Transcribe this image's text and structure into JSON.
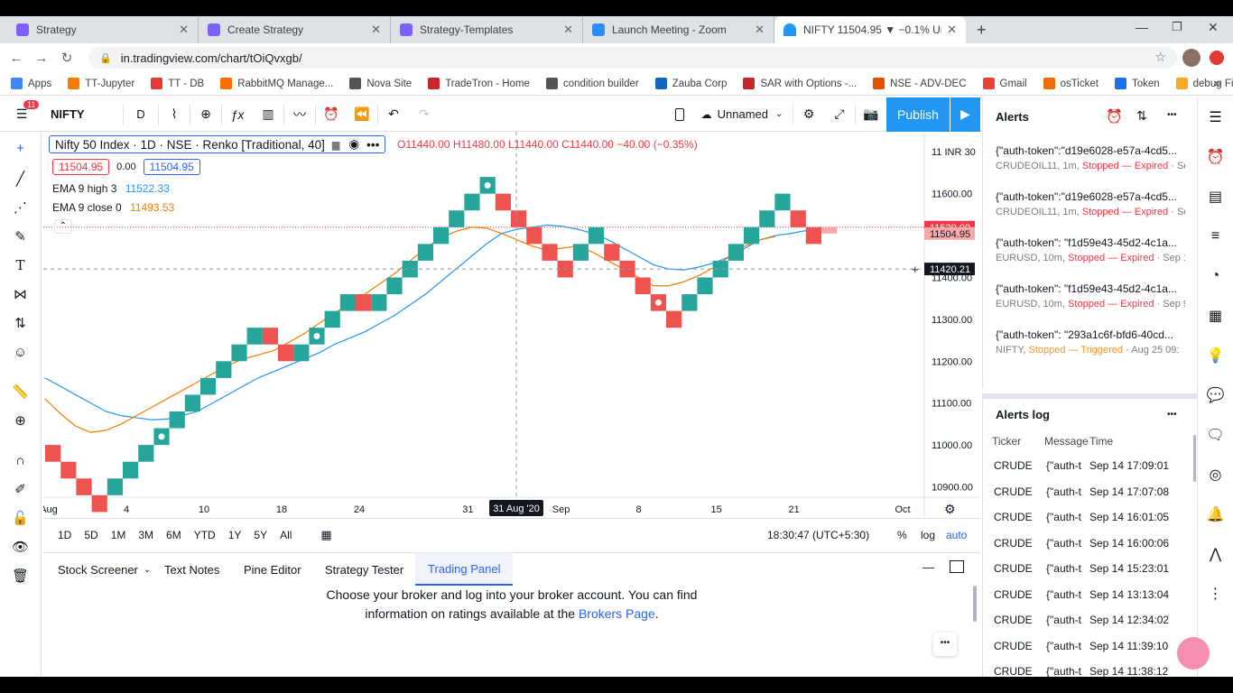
{
  "browser": {
    "tabs": [
      {
        "title": "Strategy",
        "color": "#7b61ff"
      },
      {
        "title": "Create Strategy",
        "color": "#7b61ff"
      },
      {
        "title": "Strategy-Templates",
        "color": "#7b61ff"
      },
      {
        "title": "Launch Meeting - Zoom",
        "color": "#2d8cff"
      },
      {
        "title": "NIFTY 11504.95 ▼ −0.1% Unnam",
        "color": "#2196f3"
      }
    ],
    "url": "in.tradingview.com/chart/tOiQvxgb/",
    "bookmarks": [
      {
        "label": "Apps",
        "color": "#4285f4"
      },
      {
        "label": "TT-Jupyter",
        "color": "#f57c00"
      },
      {
        "label": "TT - DB",
        "color": "#e53935"
      },
      {
        "label": "RabbitMQ Manage...",
        "color": "#ff6d00"
      },
      {
        "label": "Nova Site",
        "color": "#555555"
      },
      {
        "label": "TradeTron - Home",
        "color": "#c62828"
      },
      {
        "label": "condition builder",
        "color": "#555555"
      },
      {
        "label": "Zauba Corp",
        "color": "#1565c0"
      },
      {
        "label": "SAR with Options -...",
        "color": "#c62828"
      },
      {
        "label": "NSE - ADV-DEC",
        "color": "#e65100"
      },
      {
        "label": "Gmail",
        "color": "#ea4335"
      },
      {
        "label": "osTicket",
        "color": "#ef6c00"
      },
      {
        "label": "Token",
        "color": "#1a73e8"
      },
      {
        "label": "debug File",
        "color": "#f9a825"
      }
    ]
  },
  "toolbar": {
    "menu_badge": "11",
    "symbol": "NIFTY",
    "interval": "D",
    "layout_name": "Unnamed",
    "publish_label": "Publish"
  },
  "legend": {
    "title": "Nifty 50 Index · 1D · NSE · Renko [Traditional, 40]",
    "ohlc": "O11440.00 H11480.00 L11440.00 C11440.00 −40.00 (−0.35%)",
    "bid": "11504.95",
    "spread": "0.00",
    "ask": "11504.95",
    "ema1_label": "EMA 9 high 3",
    "ema1_value": "11522.33",
    "ema2_label": "EMA 9 close 0",
    "ema2_value": "11493.53"
  },
  "chart_data": {
    "type": "renko",
    "box_size": 40,
    "bricks": [
      {
        "i": 0,
        "dir": "down",
        "open": 11000,
        "close": 10960
      },
      {
        "i": 1,
        "dir": "down",
        "open": 10960,
        "close": 10920
      },
      {
        "i": 2,
        "dir": "down",
        "open": 10920,
        "close": 10880
      },
      {
        "i": 3,
        "dir": "down",
        "open": 10880,
        "close": 10840
      },
      {
        "i": 4,
        "dir": "up",
        "open": 10880,
        "close": 10920
      },
      {
        "i": 5,
        "dir": "up",
        "open": 10920,
        "close": 10960
      },
      {
        "i": 6,
        "dir": "up",
        "open": 10960,
        "close": 11000
      },
      {
        "i": 7,
        "dir": "up",
        "open": 11000,
        "close": 11040
      },
      {
        "i": 8,
        "dir": "up",
        "open": 11040,
        "close": 11080
      },
      {
        "i": 9,
        "dir": "up",
        "open": 11080,
        "close": 11120
      },
      {
        "i": 10,
        "dir": "up",
        "open": 11120,
        "close": 11160
      },
      {
        "i": 11,
        "dir": "up",
        "open": 11160,
        "close": 11200
      },
      {
        "i": 12,
        "dir": "up",
        "open": 11200,
        "close": 11240
      },
      {
        "i": 13,
        "dir": "up",
        "open": 11240,
        "close": 11280
      },
      {
        "i": 14,
        "dir": "down",
        "open": 11280,
        "close": 11240
      },
      {
        "i": 15,
        "dir": "down",
        "open": 11240,
        "close": 11200
      },
      {
        "i": 16,
        "dir": "up",
        "open": 11200,
        "close": 11240
      },
      {
        "i": 17,
        "dir": "up",
        "open": 11240,
        "close": 11280
      },
      {
        "i": 18,
        "dir": "up",
        "open": 11280,
        "close": 11320
      },
      {
        "i": 19,
        "dir": "up",
        "open": 11320,
        "close": 11360
      },
      {
        "i": 20,
        "dir": "down",
        "open": 11360,
        "close": 11320
      },
      {
        "i": 21,
        "dir": "up",
        "open": 11320,
        "close": 11360
      },
      {
        "i": 22,
        "dir": "up",
        "open": 11360,
        "close": 11400
      },
      {
        "i": 23,
        "dir": "up",
        "open": 11400,
        "close": 11440
      },
      {
        "i": 24,
        "dir": "up",
        "open": 11440,
        "close": 11480
      },
      {
        "i": 25,
        "dir": "up",
        "open": 11480,
        "close": 11520
      },
      {
        "i": 26,
        "dir": "up",
        "open": 11520,
        "close": 11560
      },
      {
        "i": 27,
        "dir": "up",
        "open": 11560,
        "close": 11600
      },
      {
        "i": 28,
        "dir": "up",
        "open": 11600,
        "close": 11640
      },
      {
        "i": 29,
        "dir": "down",
        "open": 11600,
        "close": 11560
      },
      {
        "i": 30,
        "dir": "down",
        "open": 11560,
        "close": 11520
      },
      {
        "i": 31,
        "dir": "down",
        "open": 11520,
        "close": 11480
      },
      {
        "i": 32,
        "dir": "down",
        "open": 11480,
        "close": 11440
      },
      {
        "i": 33,
        "dir": "down",
        "open": 11440,
        "close": 11400
      },
      {
        "i": 34,
        "dir": "up",
        "open": 11440,
        "close": 11480
      },
      {
        "i": 35,
        "dir": "up",
        "open": 11480,
        "close": 11520
      },
      {
        "i": 36,
        "dir": "down",
        "open": 11480,
        "close": 11440
      },
      {
        "i": 37,
        "dir": "down",
        "open": 11440,
        "close": 11400
      },
      {
        "i": 38,
        "dir": "down",
        "open": 11400,
        "close": 11360
      },
      {
        "i": 39,
        "dir": "down",
        "open": 11360,
        "close": 11320
      },
      {
        "i": 40,
        "dir": "down",
        "open": 11320,
        "close": 11280
      },
      {
        "i": 41,
        "dir": "up",
        "open": 11320,
        "close": 11360
      },
      {
        "i": 42,
        "dir": "up",
        "open": 11360,
        "close": 11400
      },
      {
        "i": 43,
        "dir": "up",
        "open": 11400,
        "close": 11440
      },
      {
        "i": 44,
        "dir": "up",
        "open": 11440,
        "close": 11480
      },
      {
        "i": 45,
        "dir": "up",
        "open": 11480,
        "close": 11520
      },
      {
        "i": 46,
        "dir": "up",
        "open": 11520,
        "close": 11560
      },
      {
        "i": 47,
        "dir": "up",
        "open": 11560,
        "close": 11600
      },
      {
        "i": 48,
        "dir": "down",
        "open": 11560,
        "close": 11520
      },
      {
        "i": 49,
        "dir": "down",
        "open": 11520,
        "close": 11480
      }
    ],
    "markers_at_bricks": [
      7,
      17,
      28,
      39
    ],
    "ema_high": [
      11160,
      11140,
      11120,
      11100,
      11080,
      11070,
      11065,
      11060,
      11062,
      11070,
      11080,
      11100,
      11120,
      11140,
      11160,
      11175,
      11190,
      11205,
      11220,
      11240,
      11255,
      11270,
      11290,
      11310,
      11335,
      11360,
      11390,
      11420,
      11450,
      11480,
      11505,
      11515,
      11520,
      11525,
      11522,
      11515,
      11505,
      11490,
      11470,
      11450,
      11430,
      11420,
      11418,
      11425,
      11435,
      11450,
      11470,
      11490,
      11500,
      11505,
      11512,
      11520
    ],
    "ema_close": [
      11110,
      11075,
      11045,
      11030,
      11035,
      11050,
      11070,
      11090,
      11110,
      11130,
      11150,
      11170,
      11190,
      11205,
      11215,
      11225,
      11245,
      11265,
      11290,
      11315,
      11335,
      11360,
      11385,
      11410,
      11440,
      11470,
      11495,
      11510,
      11520,
      11518,
      11505,
      11490,
      11475,
      11465,
      11470,
      11475,
      11460,
      11440,
      11420,
      11400,
      11380,
      11380,
      11390,
      11405,
      11425,
      11450,
      11475,
      11490,
      11498
    ],
    "price_axis": [
      "11 INR 30",
      "11600.00",
      "11500.00",
      "11400.00",
      "11300.00",
      "11200.00",
      "11100.00",
      "11000.00",
      "10900.00"
    ],
    "price_ticks": [
      11700,
      11600,
      11500,
      11400,
      11300,
      11200,
      11100,
      11000,
      10900
    ],
    "time_axis": [
      "Aug",
      "4",
      "10",
      "18",
      "24",
      "31",
      "Sep",
      "8",
      "15",
      "21",
      "Oct"
    ],
    "time_axis_bricks": [
      0,
      5,
      10,
      15,
      20,
      27,
      33,
      38,
      43,
      48,
      55
    ],
    "price_tags": [
      {
        "label": "11520.00",
        "price": 11520,
        "color": "#f23645"
      },
      {
        "label": "11504.95",
        "price": 11504.95,
        "color": "#f7a8a8"
      },
      {
        "label": "11420.21",
        "price": 11420.21,
        "color": "#131722"
      }
    ],
    "crosshair_date": "31 Aug '20",
    "crosshair_brick": 30,
    "crosshair_price": 11420.21,
    "up_color": "#26a69a",
    "down_color": "#ef5350",
    "ema_high_color": "#2196f3",
    "ema_close_color": "#f57c00"
  },
  "timeframes": [
    "1D",
    "5D",
    "1M",
    "3M",
    "6M",
    "YTD",
    "1Y",
    "5Y",
    "All"
  ],
  "clock": "18:30:47 (UTC+5:30)",
  "scale_opts": {
    "pct": "%",
    "log": "log",
    "auto": "auto"
  },
  "bottom_tabs": [
    "Stock Screener",
    "Text Notes",
    "Pine Editor",
    "Strategy Tester",
    "Trading Panel"
  ],
  "broker_msg_1": "Choose your broker and log into your broker account. You can find",
  "broker_msg_2": "information on ratings available at the",
  "broker_link": "Brokers Page",
  "alerts": {
    "title": "Alerts",
    "items": [
      {
        "line1": "{\"auth-token\":\"d19e6028-e57a-4cd5...",
        "sym": "CRUDEOIL11, 1m",
        "status": "Stopped — Expired",
        "extra": "Se"
      },
      {
        "line1": "{\"auth-token\":\"d19e6028-e57a-4cd5...",
        "sym": "CRUDEOIL11, 1m",
        "status": "Stopped — Expired",
        "extra": "Se"
      },
      {
        "line1": "{\"auth-token\": \"f1d59e43-45d2-4c1a...",
        "sym": "EURUSD, 10m",
        "status": "Stopped — Expired",
        "extra": "Sep 1"
      },
      {
        "line1": "{\"auth-token\": \"f1d59e43-45d2-4c1a...",
        "sym": "EURUSD, 10m",
        "status": "Stopped — Expired",
        "extra": "Sep 9"
      },
      {
        "line1": "{\"auth-token\": \"293a1c6f-bfd6-40cd...",
        "sym": "NIFTY",
        "status": "Stopped — Triggered",
        "extra": "Aug 25 09:"
      }
    ]
  },
  "alerts_log": {
    "title": "Alerts log",
    "columns": [
      "Ticker",
      "Message",
      "Time"
    ],
    "rows": [
      {
        "ticker": "CRUDE",
        "msg": "{\"auth-t",
        "time": "Sep 14 17:09:01"
      },
      {
        "ticker": "CRUDE",
        "msg": "{\"auth-t",
        "time": "Sep 14 17:07:08"
      },
      {
        "ticker": "CRUDE",
        "msg": "{\"auth-t",
        "time": "Sep 14 16:01:05"
      },
      {
        "ticker": "CRUDE",
        "msg": "{\"auth-t",
        "time": "Sep 14 16:00:06"
      },
      {
        "ticker": "CRUDE",
        "msg": "{\"auth-t",
        "time": "Sep 14 15:23:01"
      },
      {
        "ticker": "CRUDE",
        "msg": "{\"auth-t",
        "time": "Sep 14 13:13:04"
      },
      {
        "ticker": "CRUDE",
        "msg": "{\"auth-t",
        "time": "Sep 14 12:34:02"
      },
      {
        "ticker": "CRUDE",
        "msg": "{\"auth-t",
        "time": "Sep 14 11:39:10"
      },
      {
        "ticker": "CRUDE",
        "msg": "{\"auth-t",
        "time": "Sep 14 11:38:12"
      }
    ]
  },
  "colors": {
    "accent": "#2962ff",
    "publish_bg": "#2196f3"
  }
}
